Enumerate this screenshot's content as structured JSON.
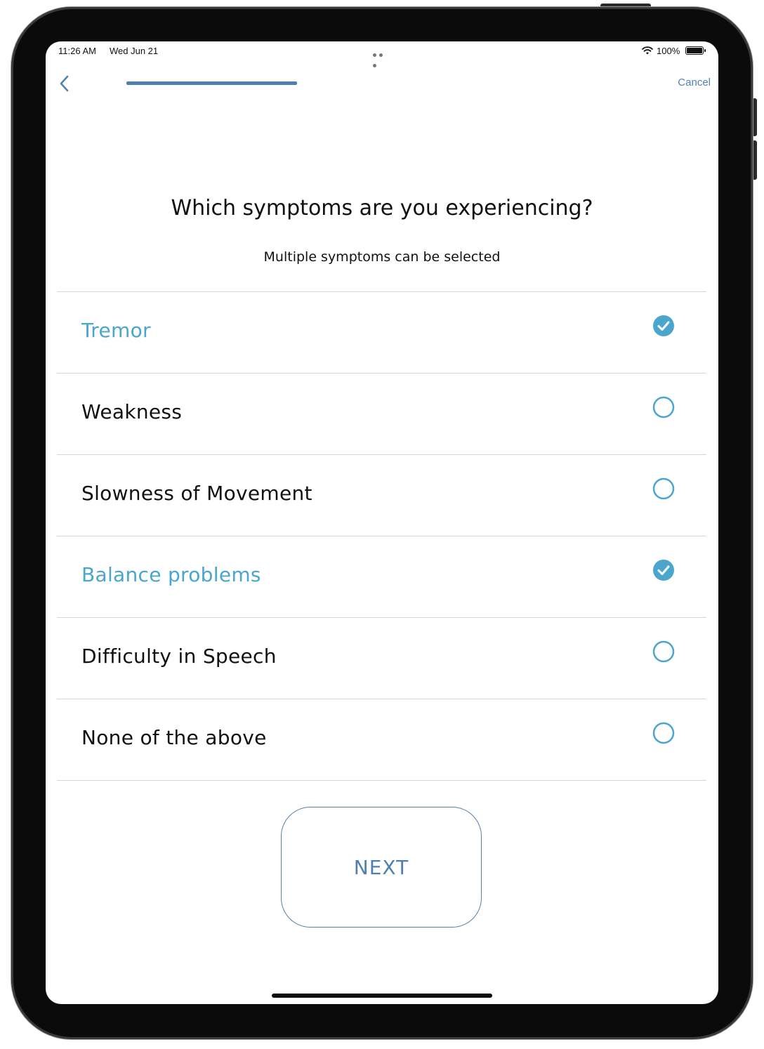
{
  "status_bar": {
    "time": "11:26 AM",
    "date": "Wed Jun 21",
    "battery": "100%"
  },
  "nav": {
    "cancel_label": "Cancel",
    "progress_icon": "progress-bar"
  },
  "question": {
    "title": "Which symptoms are you experiencing?",
    "subtitle": "Multiple symptoms can be selected"
  },
  "options": [
    {
      "label": "Tremor",
      "selected": true
    },
    {
      "label": "Weakness",
      "selected": false
    },
    {
      "label": "Slowness of Movement",
      "selected": false
    },
    {
      "label": "Balance problems",
      "selected": true
    },
    {
      "label": "Difficulty in Speech",
      "selected": false
    },
    {
      "label": "None of the above",
      "selected": false
    }
  ],
  "next_label": "NEXT",
  "colors": {
    "accent": "#4aa6cc",
    "nav_blue": "#4f7fb1",
    "text": "#111111"
  }
}
